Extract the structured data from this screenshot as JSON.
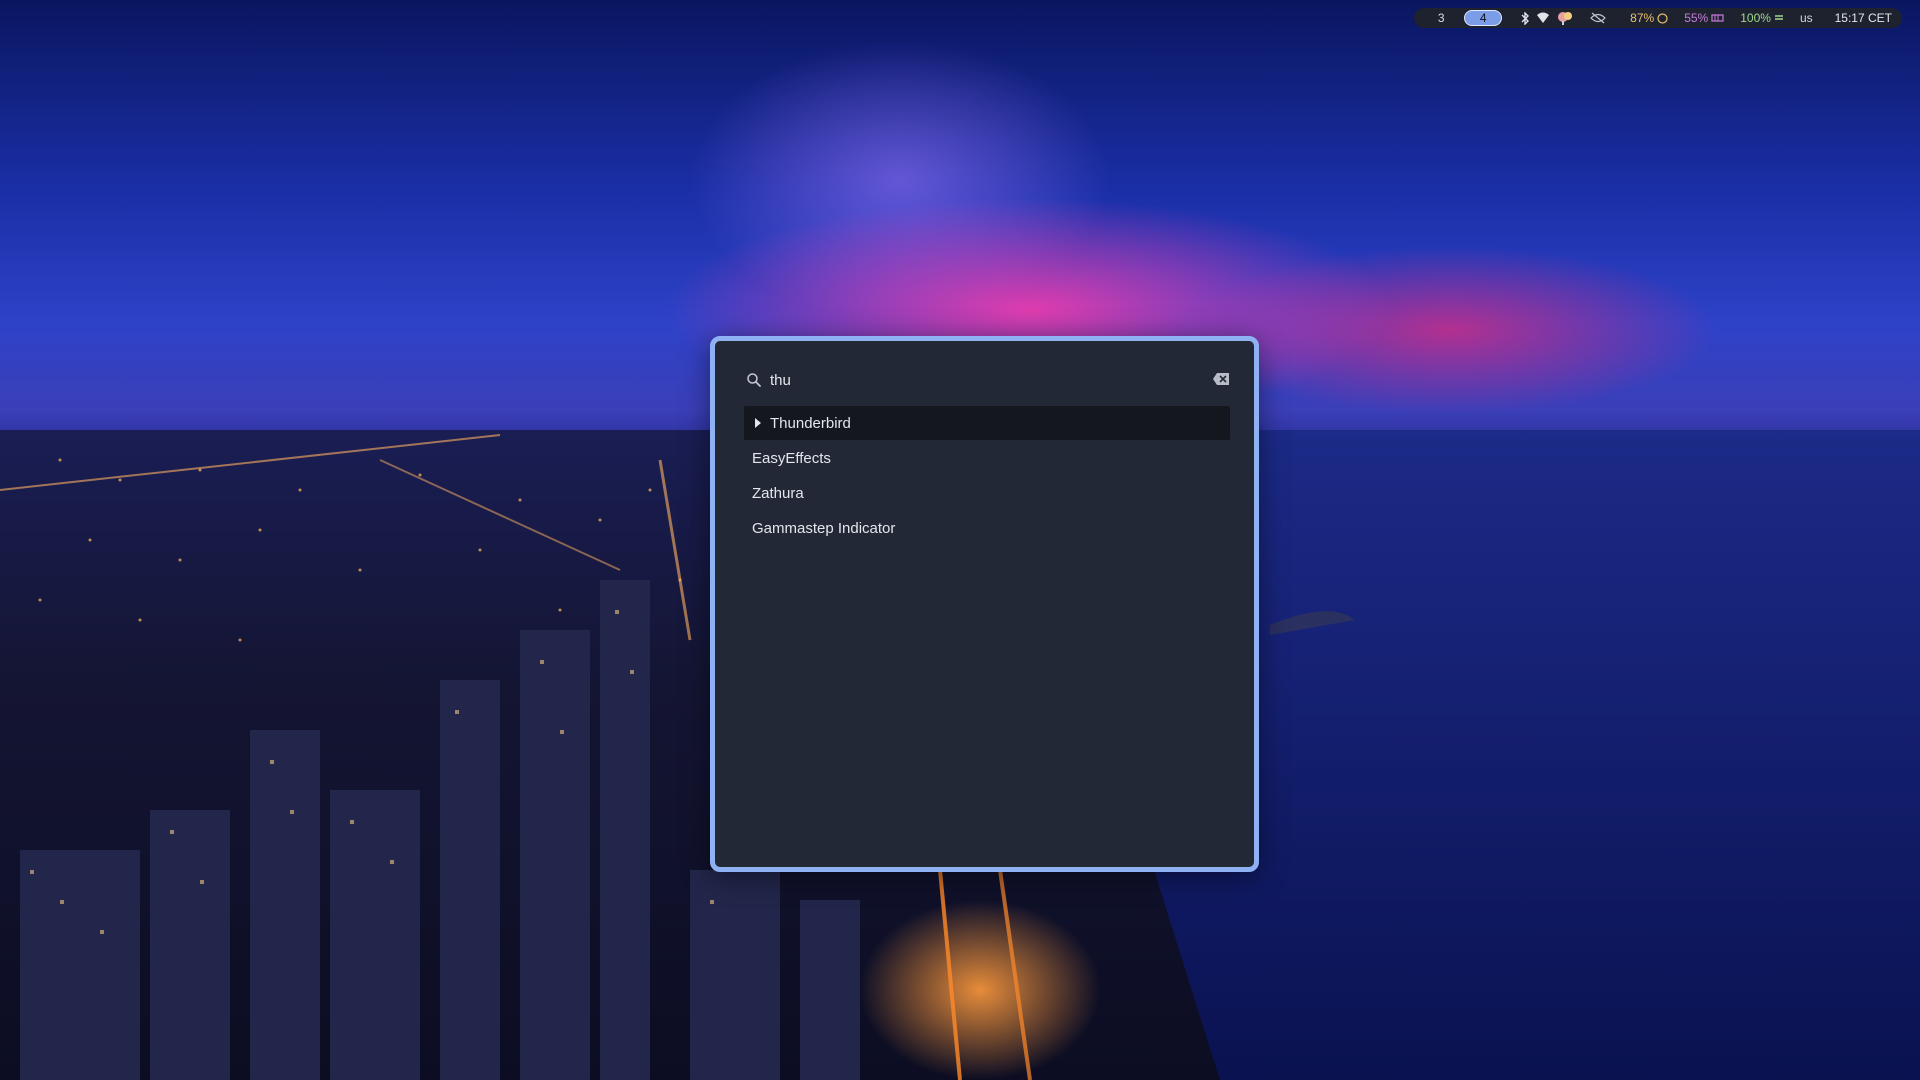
{
  "topbar": {
    "workspaces": [
      {
        "label": "3",
        "active": false
      },
      {
        "label": "4",
        "active": true
      }
    ],
    "tray_icons": [
      "bluetooth-icon",
      "wifi-icon",
      "notification-icon",
      "eye-off-icon"
    ],
    "cpu": "87%",
    "memory": "55%",
    "battery": "100%",
    "keyboard_layout": "us",
    "clock": "15:17 CET"
  },
  "launcher": {
    "search": {
      "value": "thu",
      "placeholder": ""
    },
    "results": [
      {
        "label": "Thunderbird",
        "selected": true
      },
      {
        "label": "EasyEffects",
        "selected": false
      },
      {
        "label": "Zathura",
        "selected": false
      },
      {
        "label": "Gammastep Indicator",
        "selected": false
      }
    ]
  },
  "colors": {
    "accent_border": "#8db1f2",
    "panel_bg": "#232836",
    "selected_bg": "#14171e",
    "active_workspace": "#7b9de8"
  }
}
